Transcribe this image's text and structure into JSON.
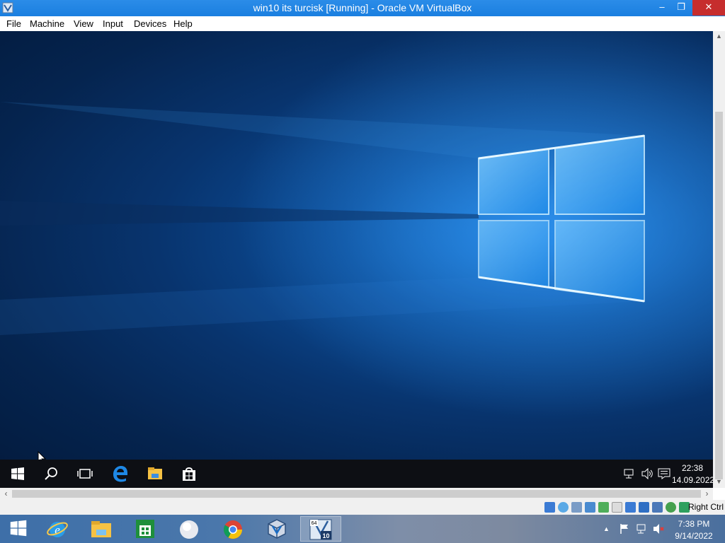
{
  "window": {
    "title": "win10 its turcisk [Running] - Oracle VM VirtualBox",
    "minimize_glyph": "–",
    "restore_glyph": "❐",
    "close_glyph": "✕"
  },
  "menu": {
    "items": [
      {
        "label": "File"
      },
      {
        "label": "Machine"
      },
      {
        "label": "View"
      },
      {
        "label": "Input"
      },
      {
        "label": "Devices"
      },
      {
        "label": "Help"
      }
    ]
  },
  "guest": {
    "wallpaper": "windows-10-hero",
    "taskbar": {
      "icons": [
        "start-icon",
        "search-icon",
        "task-view-icon",
        "edge-icon",
        "file-explorer-icon",
        "store-icon"
      ],
      "tray_icons": [
        "network-icon",
        "volume-icon",
        "action-center-icon"
      ],
      "time": "22:38",
      "date": "14.09.2022"
    }
  },
  "statusbar": {
    "icons": [
      "hard-disk-icon",
      "optical-drive-icon",
      "audio-icon",
      "network-adapter-icon",
      "usb-icon",
      "shared-folders-icon",
      "display-icon",
      "recording-icon",
      "cpu-icon",
      "vt-x-icon",
      "mouse-integration-icon"
    ],
    "host_key_label": "Right Ctrl"
  },
  "host_taskbar": {
    "apps": [
      "start-button",
      "internet-explorer-icon",
      "file-explorer-icon",
      "store-icon",
      "generic-app-icon",
      "chrome-icon",
      "virtualbox-icon",
      "vm-window-icon"
    ],
    "vm_icon_badge_top": "64",
    "vm_icon_badge_bottom": "10",
    "time": "7:38 PM",
    "date": "9/14/2022"
  },
  "colors": {
    "titlebar": "#1a7fe0",
    "close_button": "#c62d2d",
    "guest_taskbar": "#0d0f14",
    "wallpaper_light": "#9fd8ff"
  }
}
